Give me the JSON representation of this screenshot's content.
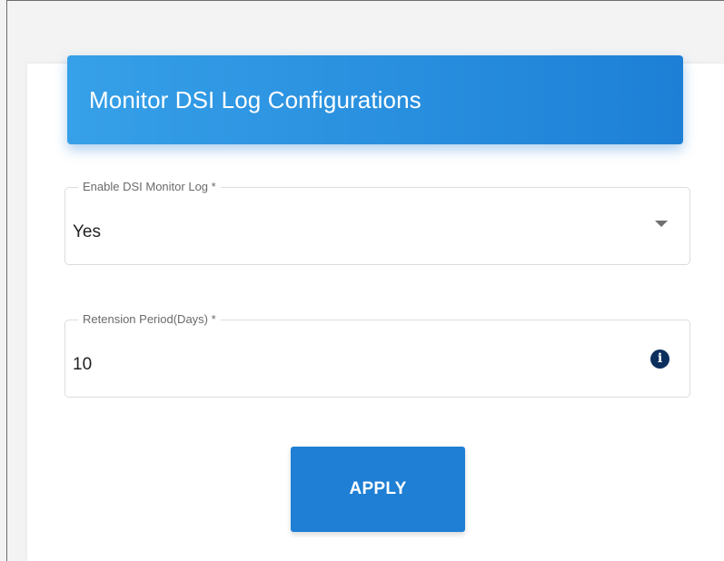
{
  "header": {
    "title": "Monitor DSI Log Configurations"
  },
  "fields": {
    "enable_log": {
      "label": "Enable DSI Monitor Log *",
      "value": "Yes",
      "icon": "chevron-down-icon"
    },
    "retention": {
      "label": "Retension Period(Days) *",
      "value": "10",
      "icon": "info-icon",
      "icon_glyph": "i"
    }
  },
  "actions": {
    "apply_label": "APPLY"
  },
  "colors": {
    "header_start": "#36a0e8",
    "header_end": "#1d80d6",
    "button": "#1f7fd4",
    "info_icon": "#0d2f5e"
  }
}
